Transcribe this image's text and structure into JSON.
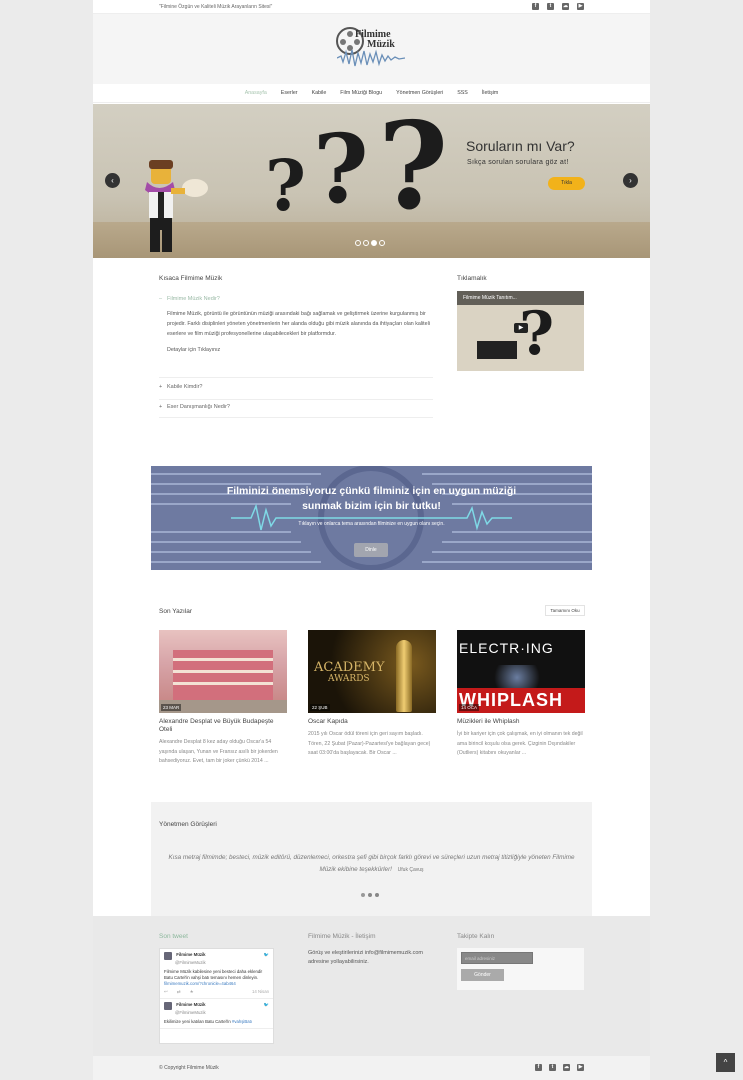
{
  "topbar": {
    "tagline": "\"Filmine Özgün ve Kaliteli Müzik Arayanların Sitesi\""
  },
  "social": [
    {
      "icon": "facebook-icon",
      "glyph": "f"
    },
    {
      "icon": "twitter-icon",
      "glyph": "t"
    },
    {
      "icon": "soundcloud-icon",
      "glyph": "☁"
    },
    {
      "icon": "youtube-icon",
      "glyph": "▶"
    }
  ],
  "logo": {
    "line1": "Filmime",
    "line2": "Müzik"
  },
  "nav": [
    "Anasayfa",
    "Eserler",
    "Kabile",
    "Film Müziği Blogu",
    "Yönetmen Görüşleri",
    "SSS",
    "İletişim"
  ],
  "slider": {
    "title": "Soruların mı Var?",
    "subtitle": "Sıkça sorulan sorulara göz at!",
    "button": "Tıkla",
    "prev": "‹",
    "next": "›",
    "active_slide": 3,
    "slide_count": 4
  },
  "intro": {
    "title": "Kısaca Filmime Müzik",
    "accordion": [
      {
        "heading": "Filmime Müzik Nedir?",
        "open": true,
        "text": "Filmime Müzik, görüntü ile görüntünün müziği arasındaki bağı sağlamak ve geliştirmek üzerine kurgulanmış bir projedir. Farklı disiplinleri yöneten yönetmenlerin her alanda olduğu gibi müzik alanında da ihtiyaçları olan kaliteli eserlere ve film müziği profesyonellerine ulaşabilecekleri bir platformdur.",
        "link": "Detaylar için Tıklayınız"
      },
      {
        "heading": "Kabile Kimdir?",
        "open": false
      },
      {
        "heading": "Eser Danışmanlığı Nedir?",
        "open": false
      }
    ]
  },
  "video": {
    "title": "Tıklamalık",
    "caption": "Filmime Müzik Tanıtım..."
  },
  "banner": {
    "line1": "Filminizi önemsiyoruz çünkü filminiz için en uygun müziği",
    "line2": "sunmak bizim için bir tutku!",
    "line3": "Tıklayın ve onlarca tema arasından filminize en uygun olanı seçin.",
    "button": "Dinle"
  },
  "posts": {
    "title": "Son Yazılar",
    "all_button": "Tamamını Oku",
    "items": [
      {
        "date": "23 MAR",
        "title": "Alexandre Desplat ve Büyük Budapeşte Oteli",
        "excerpt": "Alexandre Desplat 8 kez aday olduğu Oscar'a 54 yaşında ulaşan, Yunan ve Fransız asıllı bir jokerden bahsediyoruz. Evet, tam bir joker çünkü 2014 ..."
      },
      {
        "date": "22 ŞUB",
        "title": "Oscar Kapıda",
        "excerpt": "2015 yılı Oscar ödül töreni için geri sayım başladı. Tören, 22 Şubat (Pazar)-Pazartesi'ye bağlayan gece) saat 03:00'da başlayacak. Bir Oscar ..."
      },
      {
        "date": "14 OCA",
        "title": "Müzikleri ile Whiplash",
        "excerpt": "İyi bir kariyer için çok çalışmak, en iyi olmanın tek değil ama birincil koşulu olsa gerek. Çizginin Dışındakiler (Outliers) kitabını okuyanlar ..."
      }
    ]
  },
  "testimonials": {
    "title": "Yönetmen Görüşleri",
    "quote": "Kısa metraj filmimde; besteci, müzik editörü, düzenlemeci, orkestra şefi gibi birçok farklı görevi ve süreçleri uzun metraj titizliğiyle yöneten Filmime Müzik ekibine teşekkürler!",
    "author": "Ufuk Çavuş"
  },
  "footer": {
    "tweets_title": "Son tweet",
    "tweets": [
      {
        "name": "Filmime Müzik",
        "handle": "@FilmimeMuzik",
        "text": "Filmime Müzik kabilesine yeni besteci daha eklendi! Batu Cartel'in vahşi batı temasını hemen dinleyin.",
        "link": "filmimemuzik.com/?chronicle=4ab464",
        "time": "14 Nisan"
      },
      {
        "name": "Filmime Müzik",
        "handle": "@FilmimeMuzik",
        "text": "Ekilimize yeni katılan Batu Cartel'in",
        "link": "#vahşiBatı"
      }
    ],
    "contact_title": "Filmime Müzik - İletişim",
    "contact_text": "Görüş ve eleştirilerinizi info@filmimemuzik.com adresine yollayabilirsiniz.",
    "subscribe_title": "Takipte Kalın",
    "email_placeholder": "email adresiniz",
    "subscribe_button": "Gönder",
    "copyright": "© Copyright Filmime Müzik"
  },
  "to_top": "^"
}
